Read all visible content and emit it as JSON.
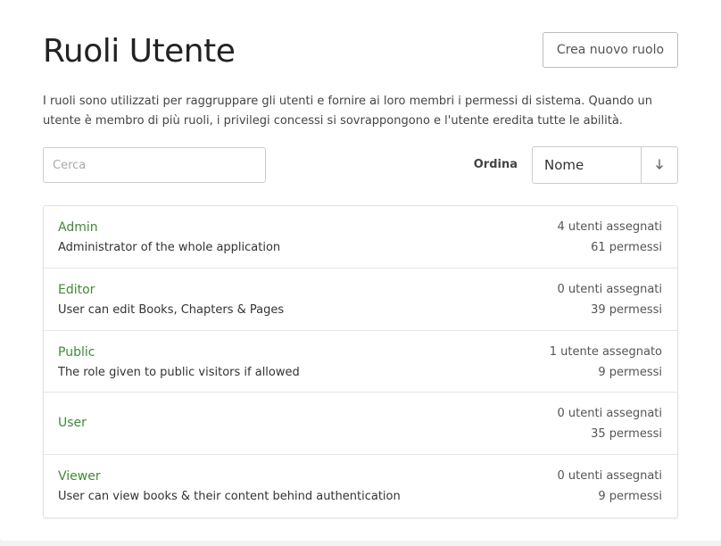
{
  "header": {
    "title": "Ruoli Utente",
    "create_button_label": "Crea nuovo ruolo"
  },
  "intro": {
    "text": "I ruoli sono utilizzati per raggruppare gli utenti e fornire ai loro membri i permessi di sistema. Quando un utente è membro di più ruoli, i privilegi concessi si sovrappongono e l'utente eredita tutte le abilità."
  },
  "search": {
    "placeholder": "Cerca",
    "value": ""
  },
  "sort": {
    "label": "Ordina",
    "selected": "Nome",
    "direction_icon": "arrow-down-icon"
  },
  "colors": {
    "role_link": "#3f8a37",
    "background": "#ffffff"
  },
  "roles": [
    {
      "name": "Admin",
      "description": "Administrator of the whole application",
      "users": "4 utenti assegnati",
      "permissions": "61 permessi"
    },
    {
      "name": "Editor",
      "description": "User can edit Books, Chapters & Pages",
      "users": "0 utenti assegnati",
      "permissions": "39 permessi"
    },
    {
      "name": "Public",
      "description": "The role given to public visitors if allowed",
      "users": "1 utente assegnato",
      "permissions": "9 permessi"
    },
    {
      "name": "User",
      "description": "",
      "users": "0 utenti assegnati",
      "permissions": "35 permessi"
    },
    {
      "name": "Viewer",
      "description": "User can view books & their content behind authentication",
      "users": "0 utenti assegnati",
      "permissions": "9 permessi"
    }
  ]
}
